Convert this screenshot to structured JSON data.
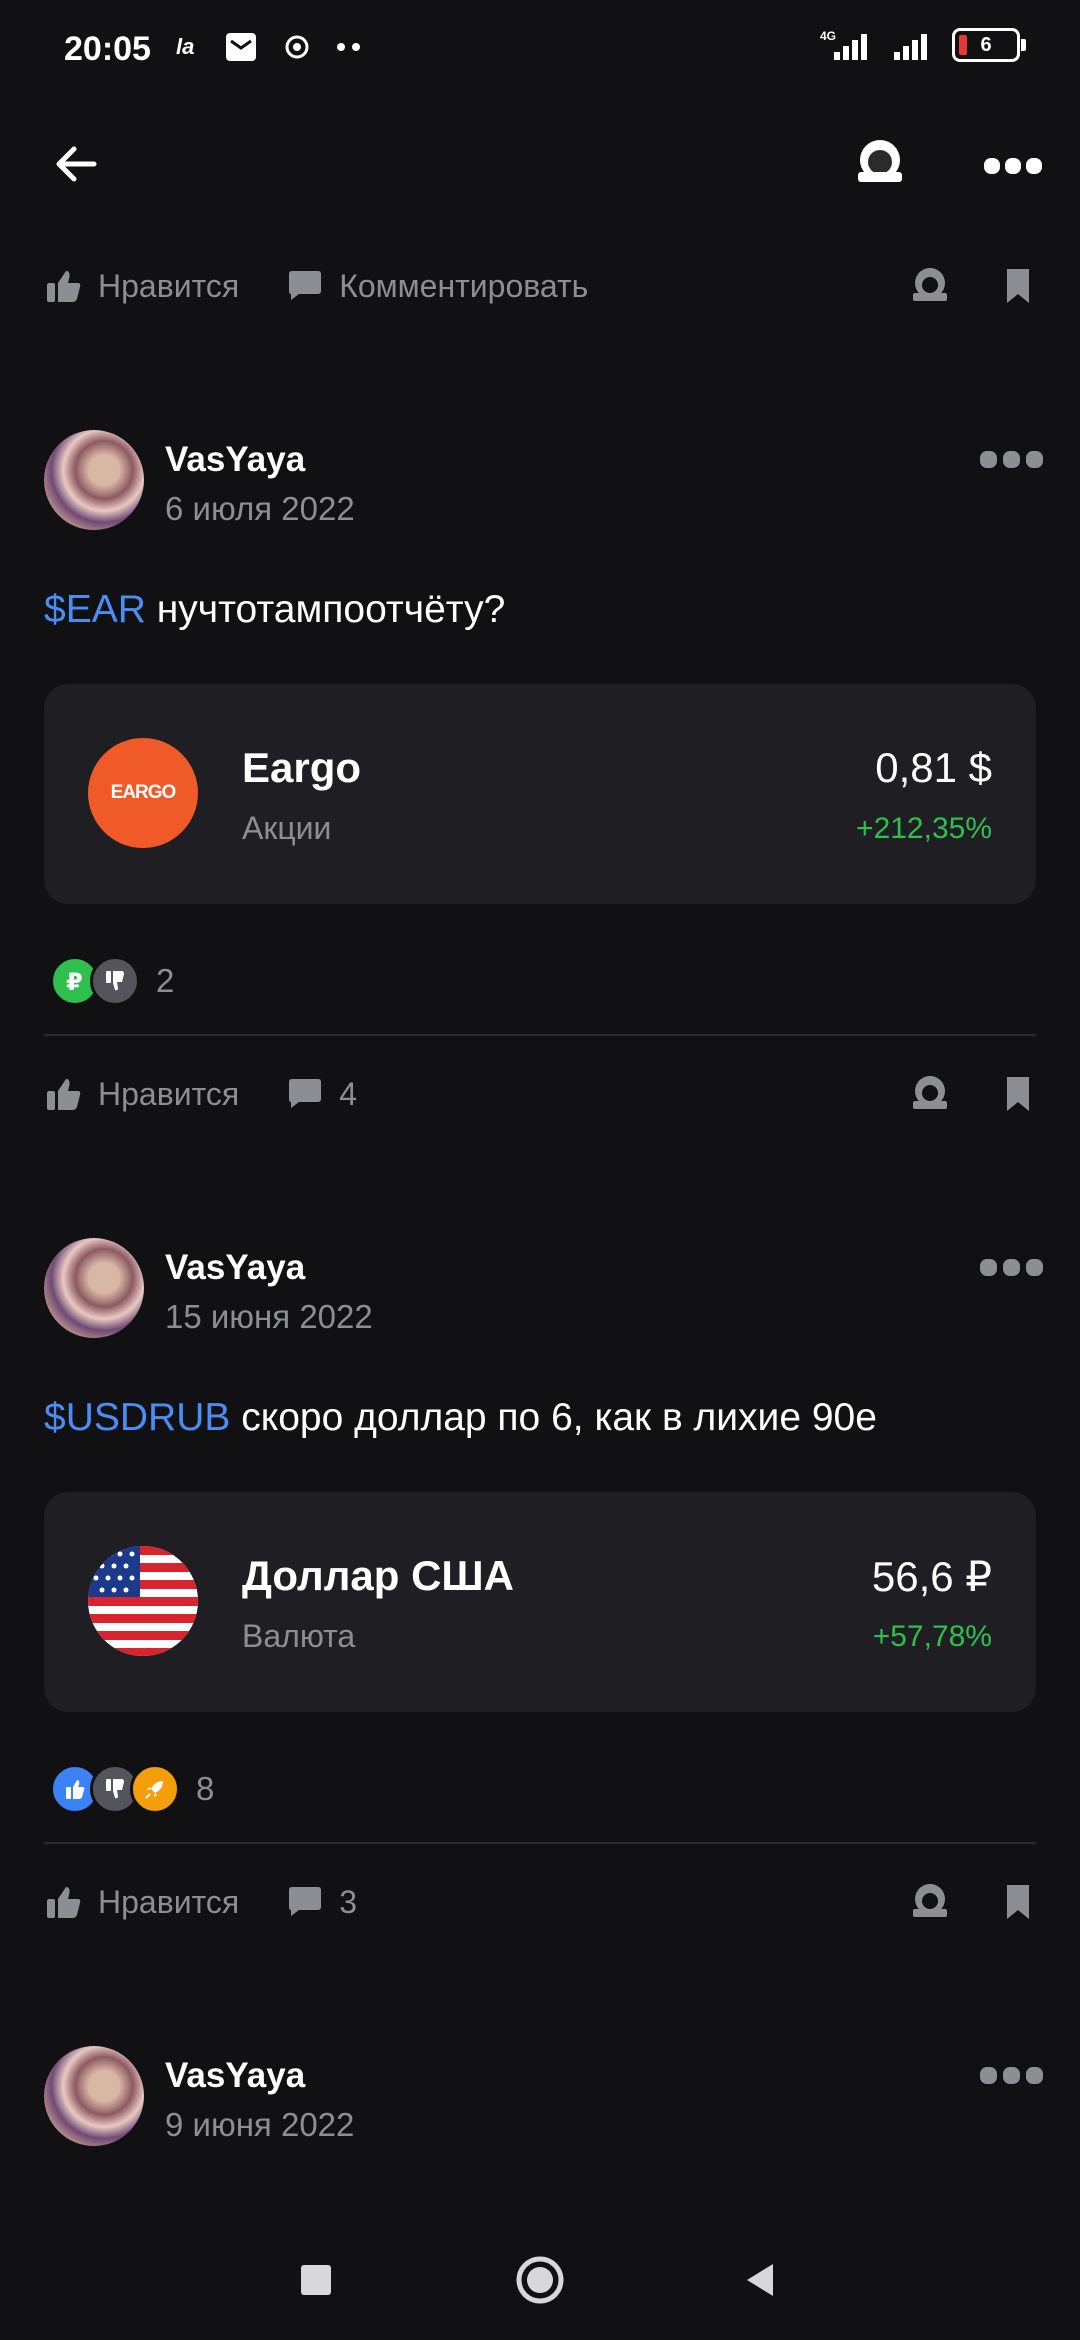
{
  "status_bar": {
    "time": "20:05",
    "network_label": "4G",
    "battery_level": "6",
    "icons": [
      "la-icon",
      "mail-icon",
      "settings-icon",
      "more-dots-icon",
      "signal-4g-icon",
      "signal-icon",
      "battery-icon"
    ]
  },
  "top_bar": {
    "back_icon": "back-arrow-icon",
    "right_icons": [
      "subscribe-icon",
      "more-icon"
    ]
  },
  "first_actions": {
    "like_label": "Нравится",
    "comment_label": "Комментировать"
  },
  "posts": [
    {
      "author": "VasYaya",
      "date": "6 июля 2022",
      "ticker": "$EAR",
      "text": " нучтотампоотчёту?",
      "asset": {
        "name": "Eargo",
        "type": "Акции",
        "price": "0,81 $",
        "change": "+212,35%",
        "logo_text": "EARGO"
      },
      "reaction_count": "2",
      "like_label": "Нравится",
      "comment_count": "4"
    },
    {
      "author": "VasYaya",
      "date": "15 июня 2022",
      "ticker": "$USDRUB",
      "text": " скоро доллар по 6, как в лихие 90е",
      "asset": {
        "name": "Доллар США",
        "type": "Валюта",
        "price": "56,6 ₽",
        "change": "+57,78%"
      },
      "reaction_count": "8",
      "like_label": "Нравится",
      "comment_count": "3"
    },
    {
      "author": "VasYaya",
      "date": "9 июня 2022"
    }
  ],
  "colors": {
    "background": "#111113",
    "card": "#1f1f23",
    "ticker": "#4a8ef5",
    "positive": "#2fbf4e",
    "muted": "#8d8d94",
    "eargo": "#f05a28"
  }
}
